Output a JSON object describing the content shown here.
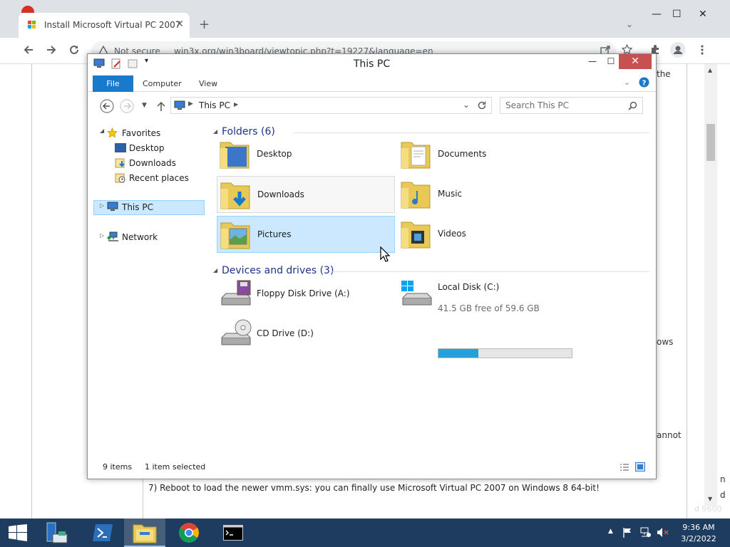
{
  "browser": {
    "tab_title": "Install Microsoft Virtual PC 2007",
    "tab_close": "✕",
    "new_tab": "+",
    "tab_list": "⌄",
    "security": "Not secure",
    "url": "win3x.org/win3board/viewtopic.php?t=19227&language=en",
    "win_min": "—",
    "win_max": "☐",
    "win_close": "✕"
  },
  "page": {
    "frag_the": "the",
    "frag_ows": "ows",
    "frag_cannot": "annot",
    "frag_n": "n",
    "frag_d": "d",
    "step7": "7) Reboot to load the newer vmm.sys: you can finally use Microsoft Virtual PC 2007 on Windows 8 64-bit!",
    "watermark": "d 9600"
  },
  "explorer": {
    "title": "This PC",
    "ribbon": {
      "file": "File",
      "computer": "Computer",
      "view": "View"
    },
    "breadcrumb": "This PC",
    "search_placeholder": "Search This PC",
    "nav": {
      "favorites": "Favorites",
      "desktop": "Desktop",
      "downloads": "Downloads",
      "recent": "Recent places",
      "this_pc": "This PC",
      "network": "Network"
    },
    "folders_header": "Folders (6)",
    "folders": [
      "Desktop",
      "Documents",
      "Downloads",
      "Music",
      "Pictures",
      "Videos"
    ],
    "devices_header": "Devices and drives (3)",
    "devices": {
      "floppy": "Floppy Disk Drive (A:)",
      "local_disk": "Local Disk (C:)",
      "local_disk_free": "41.5 GB free of 59.6 GB",
      "local_disk_used_fraction": 0.3,
      "cd": "CD Drive (D:)"
    },
    "status": {
      "items": "9 items",
      "selected": "1 item selected"
    }
  },
  "taskbar": {
    "time": "9:36 AM",
    "date": "3/2/2022"
  },
  "colors": {
    "accent": "#1979ca",
    "selection": "#cce8ff",
    "taskbar": "#1d3c5f",
    "close": "#c75050",
    "disk_bar": "#26a0da"
  }
}
